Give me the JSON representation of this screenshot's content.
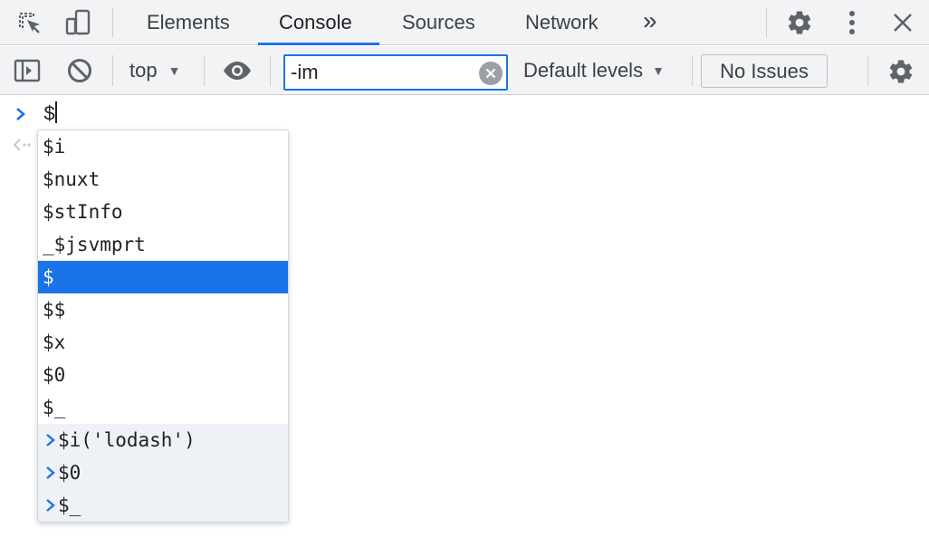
{
  "tabbar": {
    "tabs": [
      {
        "label": "Elements",
        "active": false
      },
      {
        "label": "Console",
        "active": true
      },
      {
        "label": "Sources",
        "active": false
      },
      {
        "label": "Network",
        "active": false
      }
    ],
    "more_tabs_label": "»",
    "icons": [
      "inspect-element-icon",
      "device-toolbar-icon",
      "settings-icon",
      "more-vert-icon",
      "close-icon"
    ]
  },
  "toolbar": {
    "context": "top",
    "filter": {
      "value": "-im"
    },
    "levels": "Default levels",
    "issues": "No Issues",
    "icons": [
      "sidebar-toggle-icon",
      "clear-console-icon",
      "live-expression-eye-icon",
      "clear-filter-icon",
      "console-settings-icon"
    ]
  },
  "console": {
    "prompt_text": "$"
  },
  "autocomplete": {
    "suggestions": [
      "$i",
      "$nuxt",
      "$stInfo",
      "_$jsvmprt",
      "$",
      "$$",
      "$x",
      "$0",
      "$_"
    ],
    "selected_index": 4,
    "history": [
      "$i('lodash')",
      "$0",
      "$_"
    ]
  },
  "colors": {
    "accent": "#1a73e8",
    "toolbar_bg": "#f1f3f4",
    "history_bg": "#eef1f5"
  }
}
